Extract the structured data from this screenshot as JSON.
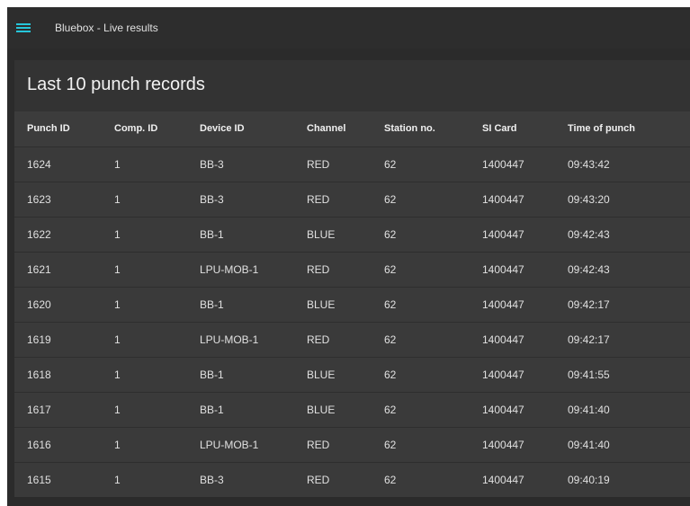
{
  "topbar": {
    "menu_icon": "hamburger-menu-icon",
    "accent_color": "#26c6da",
    "title": "Bluebox - Live results"
  },
  "card": {
    "title": "Last 10 punch records"
  },
  "table": {
    "columns": [
      "Punch ID",
      "Comp. ID",
      "Device ID",
      "Channel",
      "Station no.",
      "SI Card",
      "Time of punch"
    ],
    "rows": [
      [
        "1624",
        "1",
        "BB-3",
        "RED",
        "62",
        "1400447",
        "09:43:42"
      ],
      [
        "1623",
        "1",
        "BB-3",
        "RED",
        "62",
        "1400447",
        "09:43:20"
      ],
      [
        "1622",
        "1",
        "BB-1",
        "BLUE",
        "62",
        "1400447",
        "09:42:43"
      ],
      [
        "1621",
        "1",
        "LPU-MOB-1",
        "RED",
        "62",
        "1400447",
        "09:42:43"
      ],
      [
        "1620",
        "1",
        "BB-1",
        "BLUE",
        "62",
        "1400447",
        "09:42:17"
      ],
      [
        "1619",
        "1",
        "LPU-MOB-1",
        "RED",
        "62",
        "1400447",
        "09:42:17"
      ],
      [
        "1618",
        "1",
        "BB-1",
        "BLUE",
        "62",
        "1400447",
        "09:41:55"
      ],
      [
        "1617",
        "1",
        "BB-1",
        "BLUE",
        "62",
        "1400447",
        "09:41:40"
      ],
      [
        "1616",
        "1",
        "LPU-MOB-1",
        "RED",
        "62",
        "1400447",
        "09:41:40"
      ],
      [
        "1615",
        "1",
        "BB-3",
        "RED",
        "62",
        "1400447",
        "09:40:19"
      ]
    ]
  }
}
